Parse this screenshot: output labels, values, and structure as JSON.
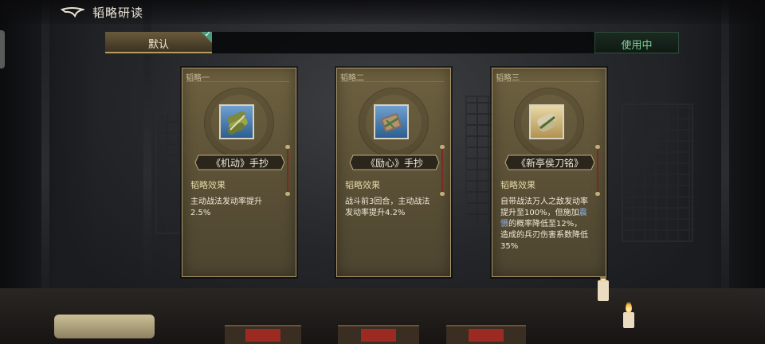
{
  "header": {
    "title": "韬略研读",
    "back_icon": "back-arrow-icon"
  },
  "preset_bar": {
    "active_tab": "默认",
    "status_button": "使用中",
    "colors": {
      "tab_active": "#6a5a3b",
      "status_text": "#7fd39a"
    }
  },
  "cards": [
    {
      "tag": "韬略一",
      "name": "《机动》手抄",
      "effect_heading": "韬略效果",
      "effect_text": "主动战法发动率提升2.5%",
      "icon": "green-scroll-bundle-icon"
    },
    {
      "tag": "韬略二",
      "name": "《励心》手抄",
      "effect_heading": "韬略效果",
      "effect_text": "战斗前3回合，主动战法发动率提升4.2%",
      "icon": "bound-book-icon"
    },
    {
      "tag": "韬略三",
      "name": "《新亭侯刀铭》",
      "effect_heading": "韬略效果",
      "effect_pre": "自带战法万人之敌发动率提升至100%，但施加",
      "effect_highlight": "震慑",
      "effect_post": "的概率降低至12%，造成的兵刃伤害系数降低35%",
      "icon": "golden-scroll-icon"
    }
  ]
}
